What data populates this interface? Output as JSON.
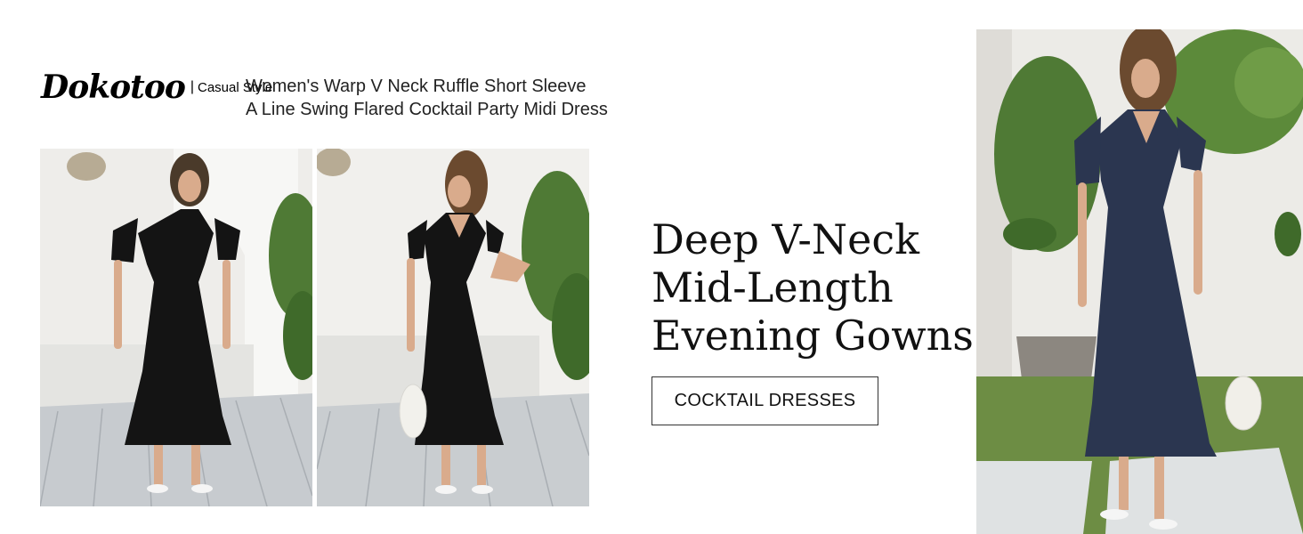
{
  "brand": {
    "logo": "Dokotoo",
    "separator": "|",
    "tagline": "Casual Style"
  },
  "product_title": {
    "line1": "Women's Warp V Neck Ruffle Short Sleeve",
    "line2": "A Line Swing Flared Cocktail Party Midi Dress"
  },
  "headline": {
    "line1": "Deep V-Neck",
    "line2": "Mid-Length",
    "line3": "Evening Gowns"
  },
  "cta": {
    "label": "COCKTAIL DRESSES"
  },
  "colors": {
    "dress_black": "#141414",
    "dress_navy": "#2b3650",
    "wall": "#f2f1ee",
    "deck": "#c9cdd0",
    "foliage": "#4f7a35"
  }
}
